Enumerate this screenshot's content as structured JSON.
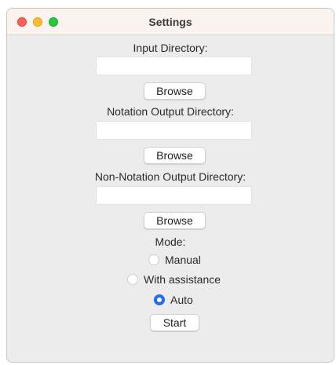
{
  "window": {
    "title": "Settings"
  },
  "input_dir": {
    "label": "Input Directory:",
    "value": "",
    "browse_label": "Browse"
  },
  "notation_dir": {
    "label": "Notation Output Directory:",
    "value": "",
    "browse_label": "Browse"
  },
  "non_notation_dir": {
    "label": "Non-Notation Output Directory:",
    "value": "",
    "browse_label": "Browse"
  },
  "mode": {
    "label": "Mode:",
    "options": [
      {
        "label": "Manual",
        "selected": false
      },
      {
        "label": "With assistance",
        "selected": false
      },
      {
        "label": "Auto",
        "selected": true
      }
    ]
  },
  "start_label": "Start",
  "colors": {
    "accent": "#1f6ff0",
    "close": "#ff5f57",
    "minimize": "#febc2e",
    "maximize": "#28c840"
  }
}
